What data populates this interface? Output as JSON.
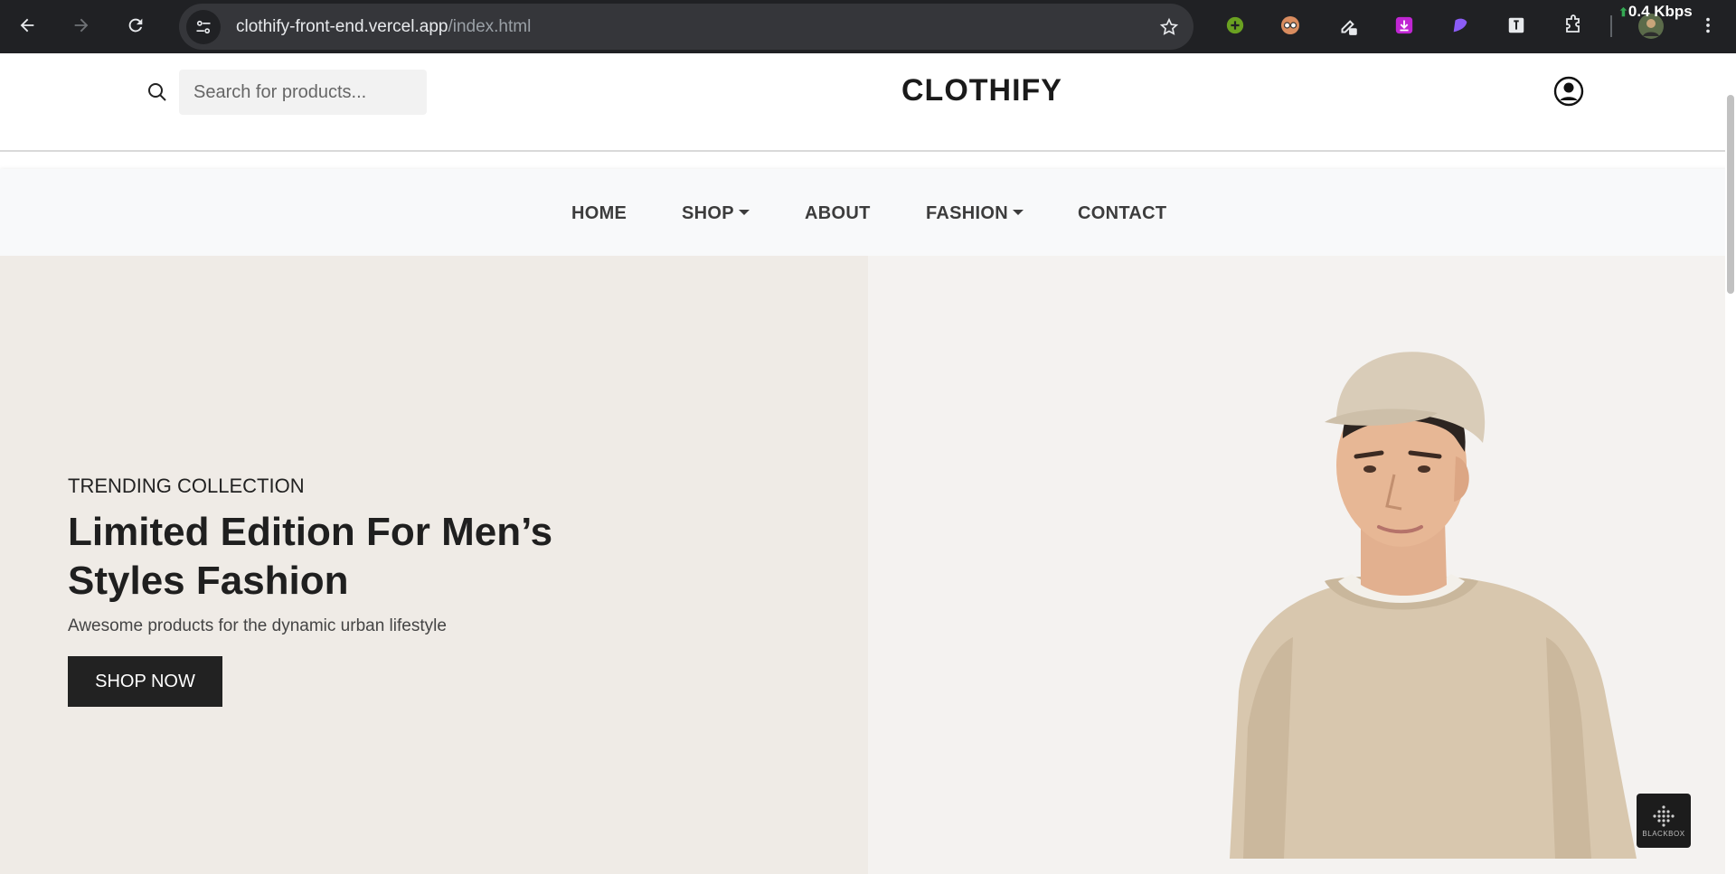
{
  "browser": {
    "url_host": "clothify-front-end.vercel.app",
    "url_path": "/index.html",
    "speed": "0.4 Kbps"
  },
  "header": {
    "search_placeholder": "Search for products...",
    "brand": "CLOTHIFY"
  },
  "nav": {
    "items": [
      {
        "label": "HOME"
      },
      {
        "label": "SHOP"
      },
      {
        "label": "ABOUT"
      },
      {
        "label": "FASHION"
      },
      {
        "label": "CONTACT"
      }
    ]
  },
  "hero": {
    "kicker": "TRENDING COLLECTION",
    "headline": "Limited Edition For Men’s Styles Fashion",
    "subtitle": "Awesome products for the dynamic urban lifestyle",
    "cta": "SHOP NOW"
  },
  "widget": {
    "label": "BLACKBOX"
  },
  "colors": {
    "chrome_bg": "#202124",
    "hero_left_bg": "#efebe6",
    "hero_right_bg": "#f4f2f0",
    "cta_bg": "#222222",
    "nav_bg": "#f8f9fa"
  }
}
